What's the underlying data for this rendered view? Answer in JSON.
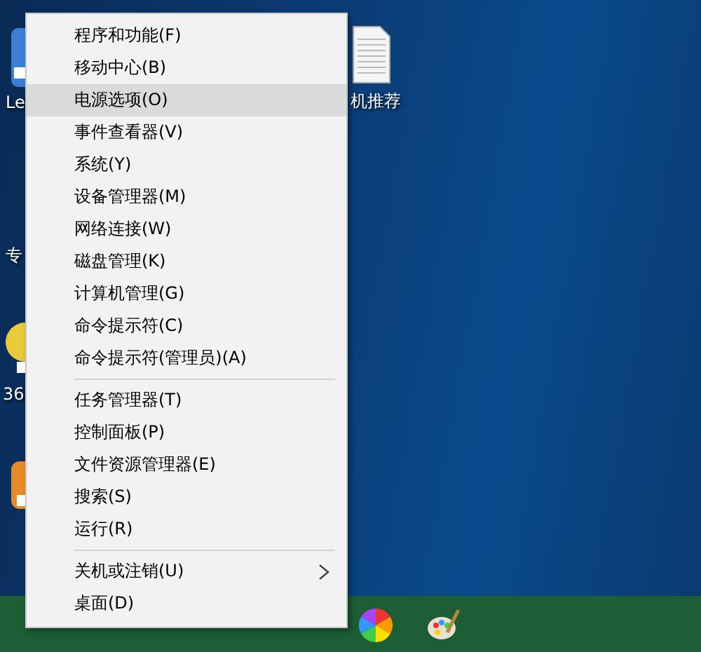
{
  "desktop_icons": [
    {
      "label": "Le",
      "kind": "app"
    },
    {
      "label": "专",
      "kind": "none"
    },
    {
      "label": "36",
      "kind": "ball"
    },
    {
      "kind": "orange"
    },
    {
      "label": "机推荐",
      "kind": "doc"
    }
  ],
  "menu": {
    "groups": [
      [
        {
          "label": "程序和功能(F)",
          "selected": false,
          "submenu": false
        },
        {
          "label": "移动中心(B)",
          "selected": false,
          "submenu": false
        },
        {
          "label": "电源选项(O)",
          "selected": true,
          "submenu": false
        },
        {
          "label": "事件查看器(V)",
          "selected": false,
          "submenu": false
        },
        {
          "label": "系统(Y)",
          "selected": false,
          "submenu": false
        },
        {
          "label": "设备管理器(M)",
          "selected": false,
          "submenu": false
        },
        {
          "label": "网络连接(W)",
          "selected": false,
          "submenu": false
        },
        {
          "label": "磁盘管理(K)",
          "selected": false,
          "submenu": false
        },
        {
          "label": "计算机管理(G)",
          "selected": false,
          "submenu": false
        },
        {
          "label": "命令提示符(C)",
          "selected": false,
          "submenu": false
        },
        {
          "label": "命令提示符(管理员)(A)",
          "selected": false,
          "submenu": false
        }
      ],
      [
        {
          "label": "任务管理器(T)",
          "selected": false,
          "submenu": false
        },
        {
          "label": "控制面板(P)",
          "selected": false,
          "submenu": false
        },
        {
          "label": "文件资源管理器(E)",
          "selected": false,
          "submenu": false
        },
        {
          "label": "搜索(S)",
          "selected": false,
          "submenu": false
        },
        {
          "label": "运行(R)",
          "selected": false,
          "submenu": false
        }
      ],
      [
        {
          "label": "关机或注销(U)",
          "selected": false,
          "submenu": true
        },
        {
          "label": "桌面(D)",
          "selected": false,
          "submenu": false
        }
      ]
    ]
  }
}
